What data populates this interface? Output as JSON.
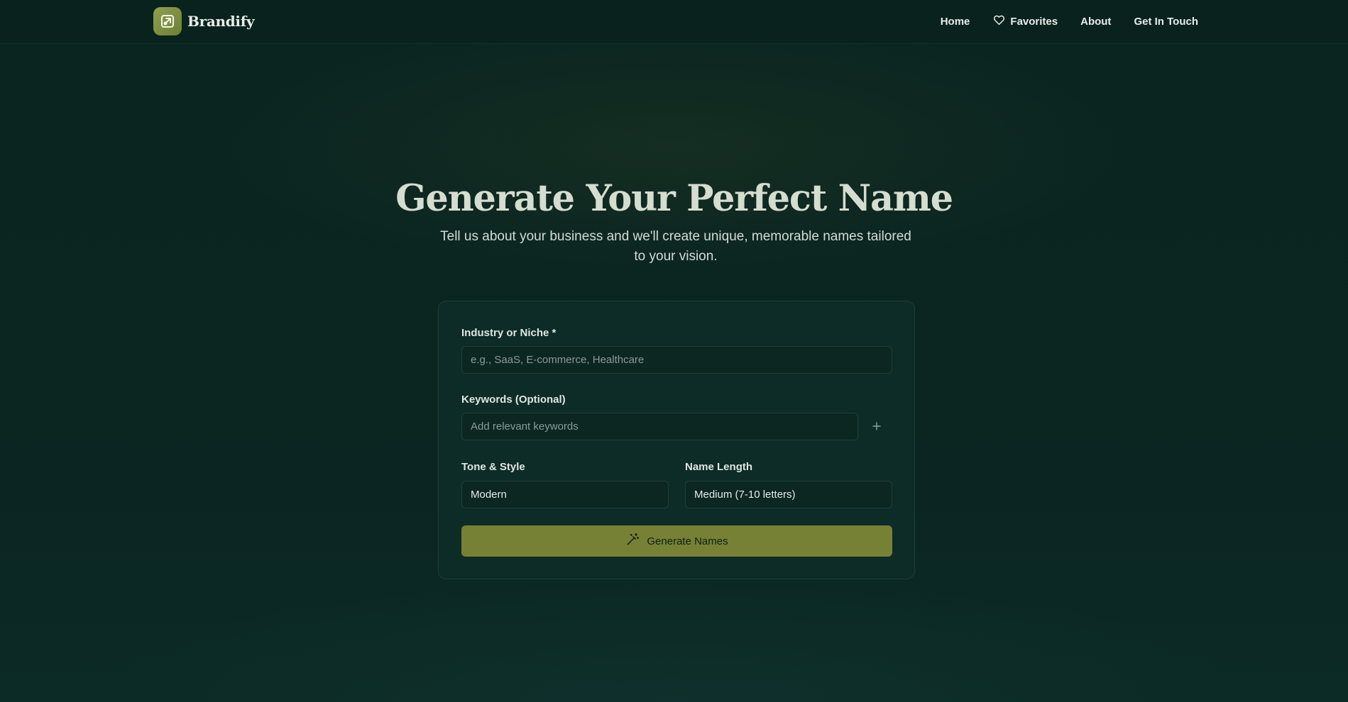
{
  "brand": {
    "name": "Brandify",
    "logo_icon": "logo-icon"
  },
  "nav": {
    "items": [
      {
        "label": "Home"
      },
      {
        "label": "Favorites",
        "icon": "heart-icon"
      },
      {
        "label": "About"
      },
      {
        "label": "Get In Touch"
      }
    ]
  },
  "hero": {
    "title": "Generate Your Perfect Name",
    "subtitle": "Tell us about your business and we'll create unique, memorable names tailored to your vision."
  },
  "form": {
    "industry": {
      "label": "Industry or Niche *",
      "placeholder": "e.g., SaaS, E-commerce, Healthcare",
      "value": ""
    },
    "keywords": {
      "label": "Keywords (Optional)",
      "placeholder": "Add relevant keywords",
      "value": "",
      "add_icon": "plus-icon"
    },
    "tone": {
      "label": "Tone & Style",
      "value": "Modern"
    },
    "length": {
      "label": "Name Length",
      "value": "Medium (7-10 letters)"
    },
    "generate_label": "Generate Names",
    "generate_icon": "magic-wand-icon"
  },
  "colors": {
    "background": "#0b2420",
    "card": "#0d2b27",
    "accent": "#778135",
    "logo": "#7f9042"
  }
}
